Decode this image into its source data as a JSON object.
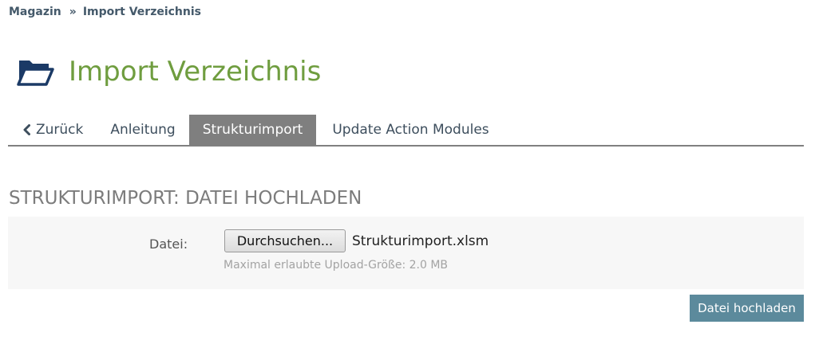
{
  "breadcrumb": {
    "items": [
      "Magazin",
      "Import Verzeichnis"
    ],
    "separator": "»"
  },
  "header": {
    "icon": "folder-open-icon",
    "title": "Import Verzeichnis",
    "title_color": "#6f9d3f"
  },
  "tabs": {
    "back": {
      "label": "Zurück",
      "icon": "chevron-left-icon"
    },
    "items": [
      {
        "label": "Anleitung",
        "active": false
      },
      {
        "label": "Strukturimport",
        "active": true
      },
      {
        "label": "Update Action Modules",
        "active": false
      }
    ]
  },
  "section": {
    "heading": "STRUKTURIMPORT: DATEI HOCHLADEN",
    "field_label": "Datei:",
    "browse_label": "Durchsuchen...",
    "file_name": "Strukturimport.xlsm",
    "help_text": "Maximal erlaubte Upload-Größe: 2.0 MB"
  },
  "actions": {
    "submit_label": "Datei hochladen",
    "submit_color": "#5c8a9c"
  }
}
